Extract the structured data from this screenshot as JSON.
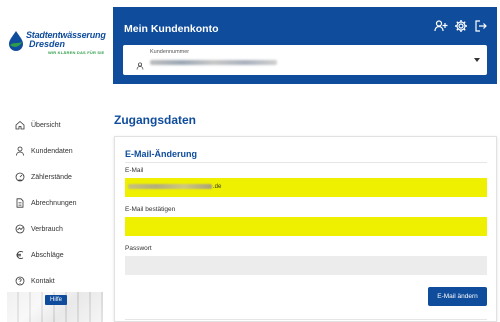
{
  "logo": {
    "line1": "Stadtentwässerung",
    "line2": "Dresden",
    "tagline": "WIR KLÄREN DAS FÜR SIE"
  },
  "header": {
    "title": "Mein Kundenkonto",
    "icons": [
      "add-user-icon",
      "settings-icon",
      "logout-icon"
    ],
    "customer_select": {
      "label": "Kundennummer",
      "value_blurred": true
    }
  },
  "sidebar": {
    "items": [
      {
        "label": "Übersicht",
        "icon": "home-icon"
      },
      {
        "label": "Kundendaten",
        "icon": "user-icon"
      },
      {
        "label": "Zählerstände",
        "icon": "meter-icon"
      },
      {
        "label": "Abrechnungen",
        "icon": "document-icon"
      },
      {
        "label": "Verbrauch",
        "icon": "chart-icon"
      },
      {
        "label": "Abschläge",
        "icon": "euro-icon"
      },
      {
        "label": "Kontakt",
        "icon": "question-icon"
      }
    ],
    "help_label": "Hilfe"
  },
  "main": {
    "page_title": "Zugangsdaten",
    "section_title": "E-Mail-Änderung",
    "email_label": "E-Mail",
    "email_domain_suffix": ".de",
    "email_confirm_label": "E-Mail bestätigen",
    "password_label": "Passwort",
    "submit_label": "E-Mail ändern"
  },
  "colors": {
    "brand_blue": "#0f4c9c",
    "highlight_yellow": "#eef000",
    "brand_green": "#2e9e4a"
  }
}
